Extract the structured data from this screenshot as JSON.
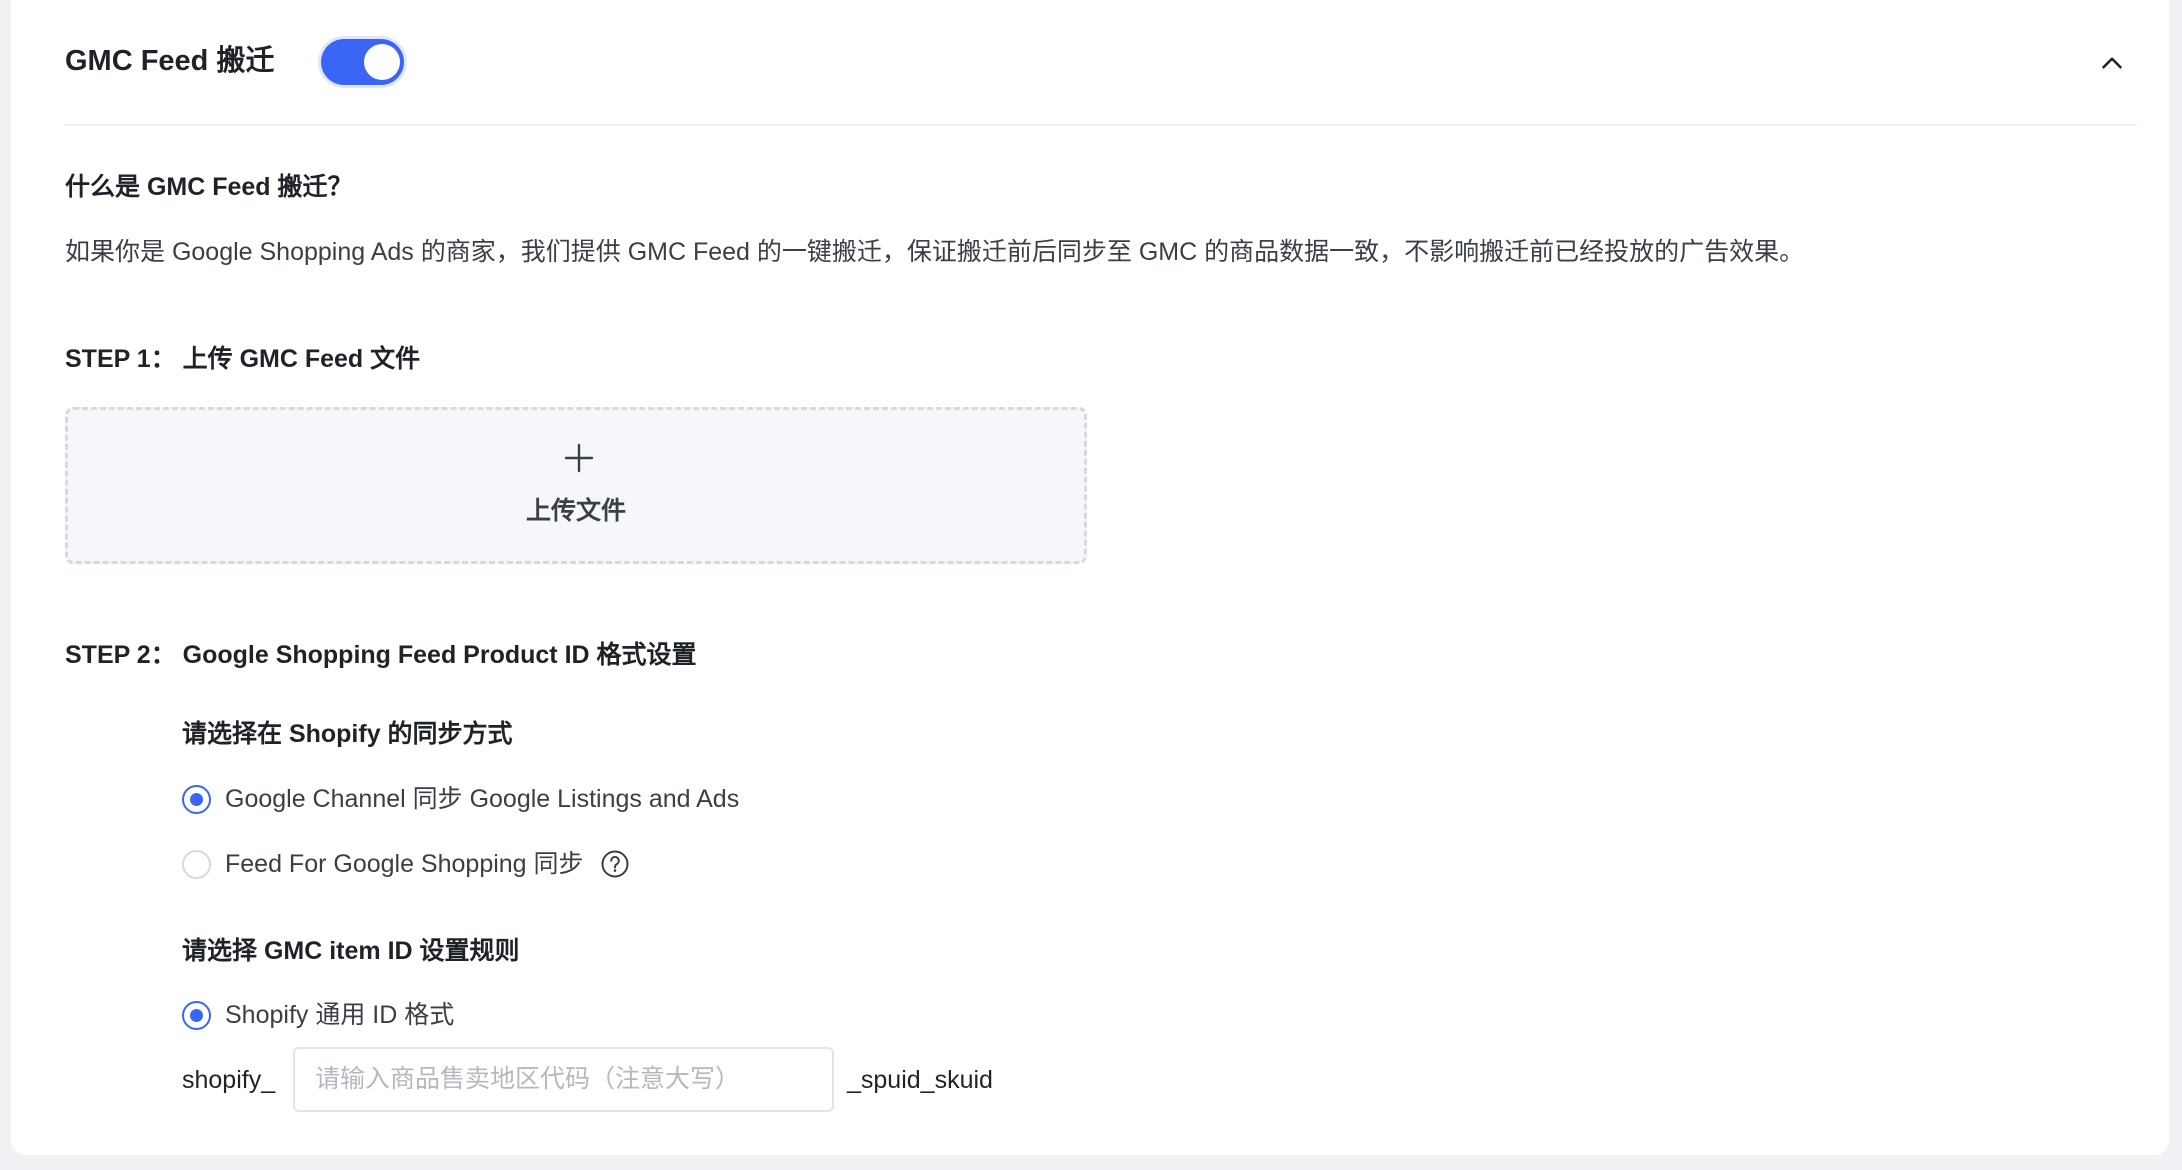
{
  "header": {
    "title": "GMC Feed 搬迁",
    "toggle_on": true,
    "collapse_icon": "chevron-up-icon"
  },
  "intro": {
    "question": "什么是 GMC Feed 搬迁？",
    "description": "如果你是 Google Shopping Ads 的商家，我们提供 GMC Feed 的一键搬迁，保证搬迁前后同步至 GMC 的商品数据一致，不影响搬迁前已经投放的广告效果。"
  },
  "step1": {
    "title": "STEP 1： 上传 GMC Feed 文件",
    "upload_icon": "plus-icon",
    "upload_label": "上传文件"
  },
  "step2": {
    "title": "STEP 2： Google Shopping Feed Product ID 格式设置",
    "sync_method": {
      "title": "请选择在 Shopify 的同步方式",
      "options": [
        {
          "label": "Google Channel 同步 Google Listings and Ads",
          "checked": true
        },
        {
          "label": "Feed For Google Shopping 同步",
          "checked": false,
          "help_icon": "question-circle-icon"
        }
      ]
    },
    "id_rule": {
      "title": "请选择 GMC item ID 设置规则",
      "options": [
        {
          "label": "Shopify 通用 ID 格式",
          "checked": true
        }
      ],
      "prefix": "shopify_",
      "input_value": "",
      "input_placeholder": "请输入商品售卖地区代码（注意大写）",
      "suffix": "_spuid_skuid"
    }
  },
  "colors": {
    "accent": "#3b66f5",
    "background": "#f0f1f5",
    "card": "#ffffff",
    "upload_bg": "#f6f7fa"
  }
}
